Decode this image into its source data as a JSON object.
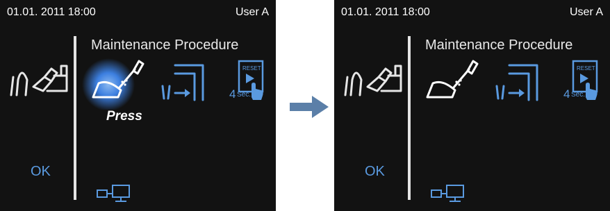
{
  "screens": [
    {
      "state": "before",
      "datetime": "01.01. 2011 18:00",
      "user": "User A",
      "title": "Maintenance Procedure",
      "ok_label": "OK",
      "press_label": "Press",
      "reset_label": "RESET",
      "seconds_number": "4",
      "seconds_unit": "Sec."
    },
    {
      "state": "after",
      "datetime": "01.01. 2011 18:00",
      "user": "User A",
      "title": "Maintenance Procedure",
      "ok_label": "OK",
      "reset_label": "RESET",
      "seconds_number": "4",
      "seconds_unit": "Sec."
    }
  ],
  "colors": {
    "accent": "#5a9ae0",
    "highlight": "#3c7fe0",
    "background": "#121212",
    "arrow": "#5b7fa8"
  },
  "icons": [
    "handpiece-icon",
    "oil-spray-icon",
    "tube-drain-icon",
    "reset-icon",
    "pc-connection-icon",
    "transition-arrow-icon"
  ]
}
